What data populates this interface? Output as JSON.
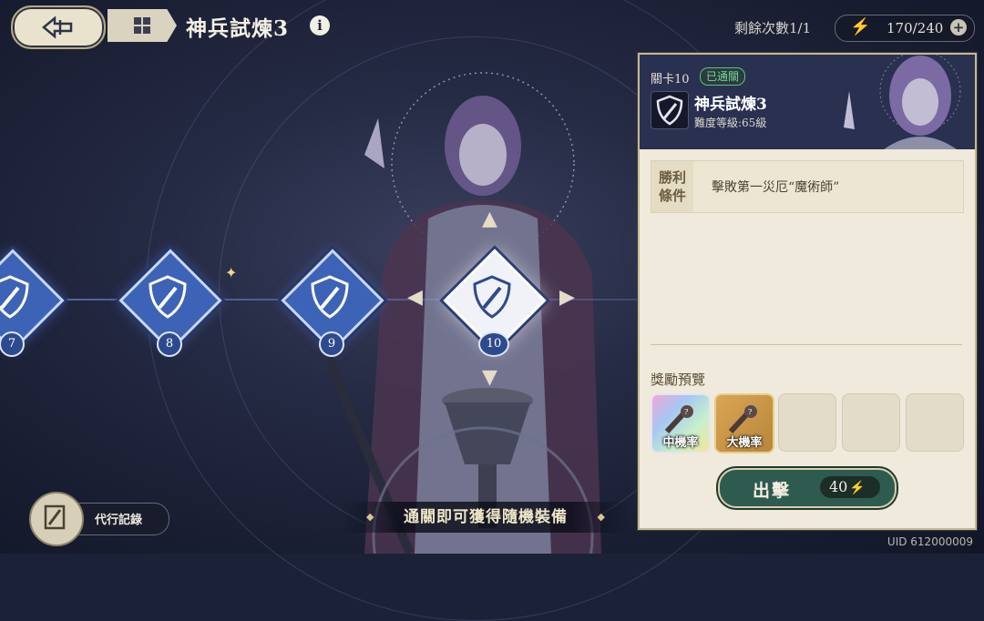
{
  "header": {
    "title": "神兵試煉3",
    "info_icon": "i",
    "attempts": "剩餘次數1/1",
    "energy": "170/240",
    "energy_plus": "+"
  },
  "stages": [
    {
      "num": "7",
      "state": "cleared"
    },
    {
      "num": "8",
      "state": "cleared"
    },
    {
      "num": "9",
      "state": "cleared"
    },
    {
      "num": "10",
      "state": "current"
    }
  ],
  "bottom": {
    "proxy_label": "代行記錄",
    "banner": "通關即可獲得隨機裝備",
    "uid": "UID 612000009"
  },
  "panel": {
    "stage_label": "關卡10",
    "cleared_badge": "已通關",
    "stage_name": "神兵試煉3",
    "difficulty": "難度等級:65級",
    "condition_label_1": "勝利",
    "condition_label_2": "條件",
    "condition_text": "擊敗第一災厄“魔術師”",
    "reward_title": "獎勵預覽",
    "rewards": [
      {
        "label": "中機率",
        "rarity": "rainbow"
      },
      {
        "label": "大機率",
        "rarity": "gold"
      }
    ],
    "sortie_label": "出擊",
    "sortie_cost": "40"
  },
  "colors": {
    "node_blue": "#3c63b6",
    "panel_bg": "#efeadb",
    "sortie_green": "#2f5a50",
    "cleared_green": "#79d694",
    "energy_gold": "#d9b45a"
  },
  "icons": [
    "back-arrow-icon",
    "menu-grid-icon",
    "info-icon",
    "lightning-icon",
    "plus-icon",
    "shield-sword-icon",
    "proxy-record-icon"
  ]
}
